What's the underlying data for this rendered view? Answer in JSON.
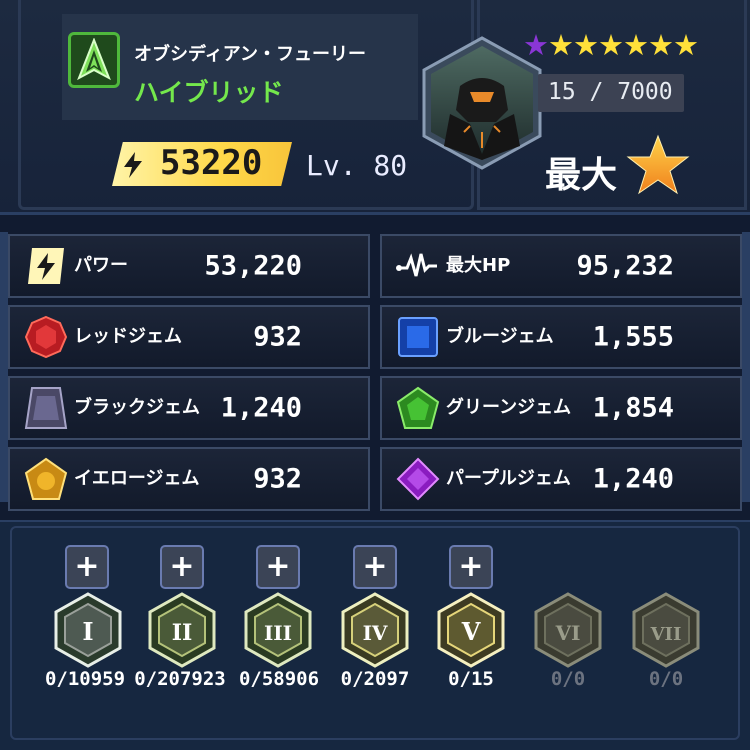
{
  "hero": {
    "name": "オブシディアン・フューリー",
    "class": "ハイブリッド",
    "power": "53220",
    "level": "Lv. 80",
    "stars_purple": "★",
    "stars_gold": "★★★★★★",
    "shard_progress": "15 / 7000",
    "max_label": "最大"
  },
  "stats": [
    {
      "label": "パワー",
      "value": "53,220",
      "icon": "power-bolt-icon"
    },
    {
      "label": "最大HP",
      "value": "95,232",
      "icon": "heartbeat-icon"
    },
    {
      "label": "レッドジェム",
      "value": "932",
      "icon": "red-gem-icon",
      "color": "#d6242a"
    },
    {
      "label": "ブルージェム",
      "value": "1,555",
      "icon": "blue-gem-icon",
      "color": "#1e5ad8"
    },
    {
      "label": "ブラックジェム",
      "value": "1,240",
      "icon": "black-gem-icon",
      "color": "#5b5a7a"
    },
    {
      "label": "グリーンジェム",
      "value": "1,854",
      "icon": "green-gem-icon",
      "color": "#3aa22c"
    },
    {
      "label": "イエロージェム",
      "value": "932",
      "icon": "yellow-gem-icon",
      "color": "#e0a21c"
    },
    {
      "label": "パープルジェム",
      "value": "1,240",
      "icon": "purple-gem-icon",
      "color": "#9b2ad0"
    }
  ],
  "gear_tiers": [
    {
      "roman": "I",
      "count": "0/10959",
      "active": true,
      "plus": "+"
    },
    {
      "roman": "II",
      "count": "0/207923",
      "active": true,
      "plus": "+"
    },
    {
      "roman": "III",
      "count": "0/58906",
      "active": true,
      "plus": "+"
    },
    {
      "roman": "IV",
      "count": "0/2097",
      "active": true,
      "plus": "+"
    },
    {
      "roman": "V",
      "count": "0/15",
      "active": true,
      "plus": "+"
    },
    {
      "roman": "VI",
      "count": "0/0",
      "active": false
    },
    {
      "roman": "VII",
      "count": "0/0",
      "active": false
    }
  ]
}
